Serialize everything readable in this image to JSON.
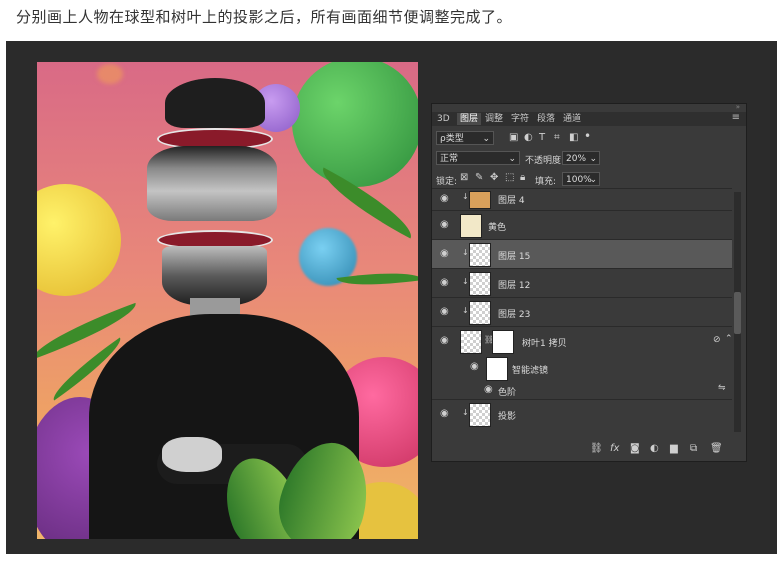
{
  "caption": "分别画上人物在球型和树叶上的投影之后，所有画面细节便调整完成了。",
  "panel": {
    "tabs": [
      "3D",
      "图层",
      "调整",
      "字符",
      "段落",
      "通道"
    ],
    "filter_kind": "ρ类型",
    "blend_mode": "正常",
    "opacity_label": "不透明度:",
    "opacity_value": "20%",
    "lock_label": "锁定:",
    "fill_label": "填充:",
    "fill_value": "100%",
    "layers": [
      {
        "name": "图层 4"
      },
      {
        "name": "黄色"
      },
      {
        "name": "图层 15"
      },
      {
        "name": "图层 12"
      },
      {
        "name": "图层 23"
      },
      {
        "name": "树叶1 拷贝"
      },
      {
        "name": "智能滤镜"
      },
      {
        "name": "色阶"
      },
      {
        "name": "投影"
      }
    ],
    "bottom_icons": [
      "link-icon",
      "fx-icon",
      "mask-icon",
      "adjustment-icon",
      "folder-icon",
      "new-layer-icon",
      "trash-icon"
    ]
  },
  "colors": {
    "panel_bg": "#3a3a3a",
    "selected_row": "#595959",
    "frame_bg": "#2b2b2b"
  }
}
